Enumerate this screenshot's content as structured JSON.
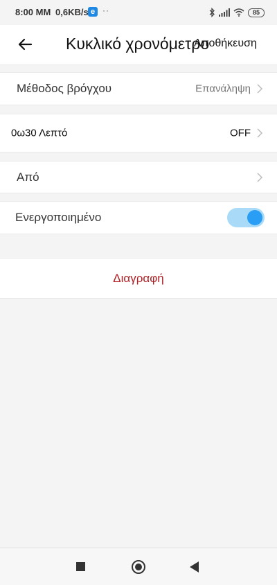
{
  "status_bar": {
    "time": "8:00 MM",
    "speed": "0,6KB/s",
    "app_icon_letter": "e",
    "dots": "··",
    "battery": "85",
    "icons": [
      "bluetooth-icon",
      "signal-icon",
      "wifi-icon",
      "battery-icon"
    ]
  },
  "header": {
    "title": "Κυκλικό χρονόμετρο",
    "save_label": "Αποθήκευση",
    "back_icon": "arrow-left-icon"
  },
  "settings": {
    "loop_method": {
      "label": "Μέθοδος βρόγχου",
      "value": "Επανάληψη"
    },
    "interval": {
      "label": "0ω30 Λεπτό",
      "value": "OFF"
    },
    "from": {
      "label": "Από"
    },
    "enabled": {
      "label": "Ενεργοποιημένο",
      "on": true
    }
  },
  "delete_label": "Διαγραφή",
  "colors": {
    "accent": "#2a9df4",
    "toggle_track": "#a9dbf8",
    "delete": "#b01f24",
    "background": "#f4f4f4"
  }
}
